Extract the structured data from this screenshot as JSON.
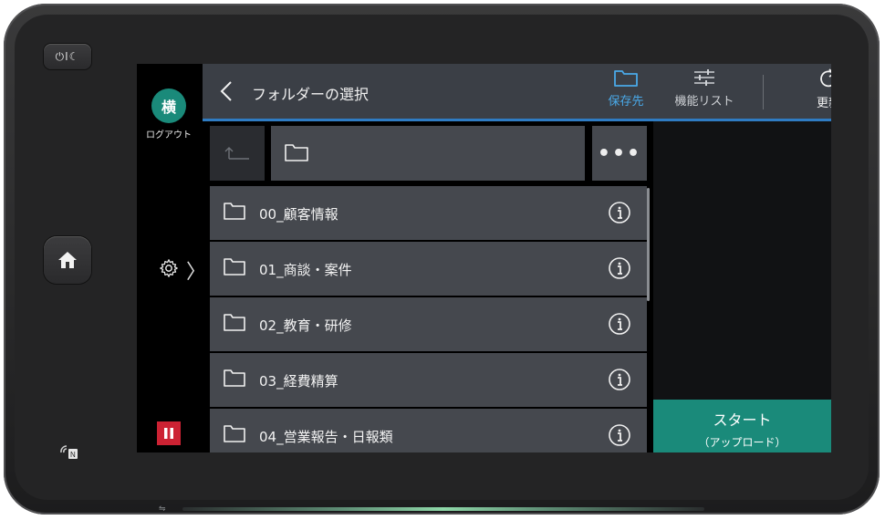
{
  "device": {
    "power_symbols": "⏻I☾",
    "usb_symbol": "⇋"
  },
  "sidebar": {
    "avatar_initial": "横",
    "logout_label": "ログアウト",
    "settings_chevron": "〉",
    "pause_icon": "pause-icon"
  },
  "header": {
    "title": "フォルダーの選択",
    "destination_label": "保存先",
    "feature_list_label": "機能リスト",
    "refresh_label": "更新"
  },
  "path_bar": {
    "more_label": "•••"
  },
  "folders": [
    {
      "name": "00_顧客情報"
    },
    {
      "name": "01_商談・案件"
    },
    {
      "name": "02_教育・研修"
    },
    {
      "name": "03_経費精算"
    },
    {
      "name": "04_営業報告・日報類"
    }
  ],
  "start_button": {
    "label": "スタート",
    "sublabel": "（アップロード）"
  },
  "colors": {
    "accent_teal": "#1a8a7a",
    "accent_blue": "#2f7cc3",
    "pause_red": "#cc2233"
  }
}
